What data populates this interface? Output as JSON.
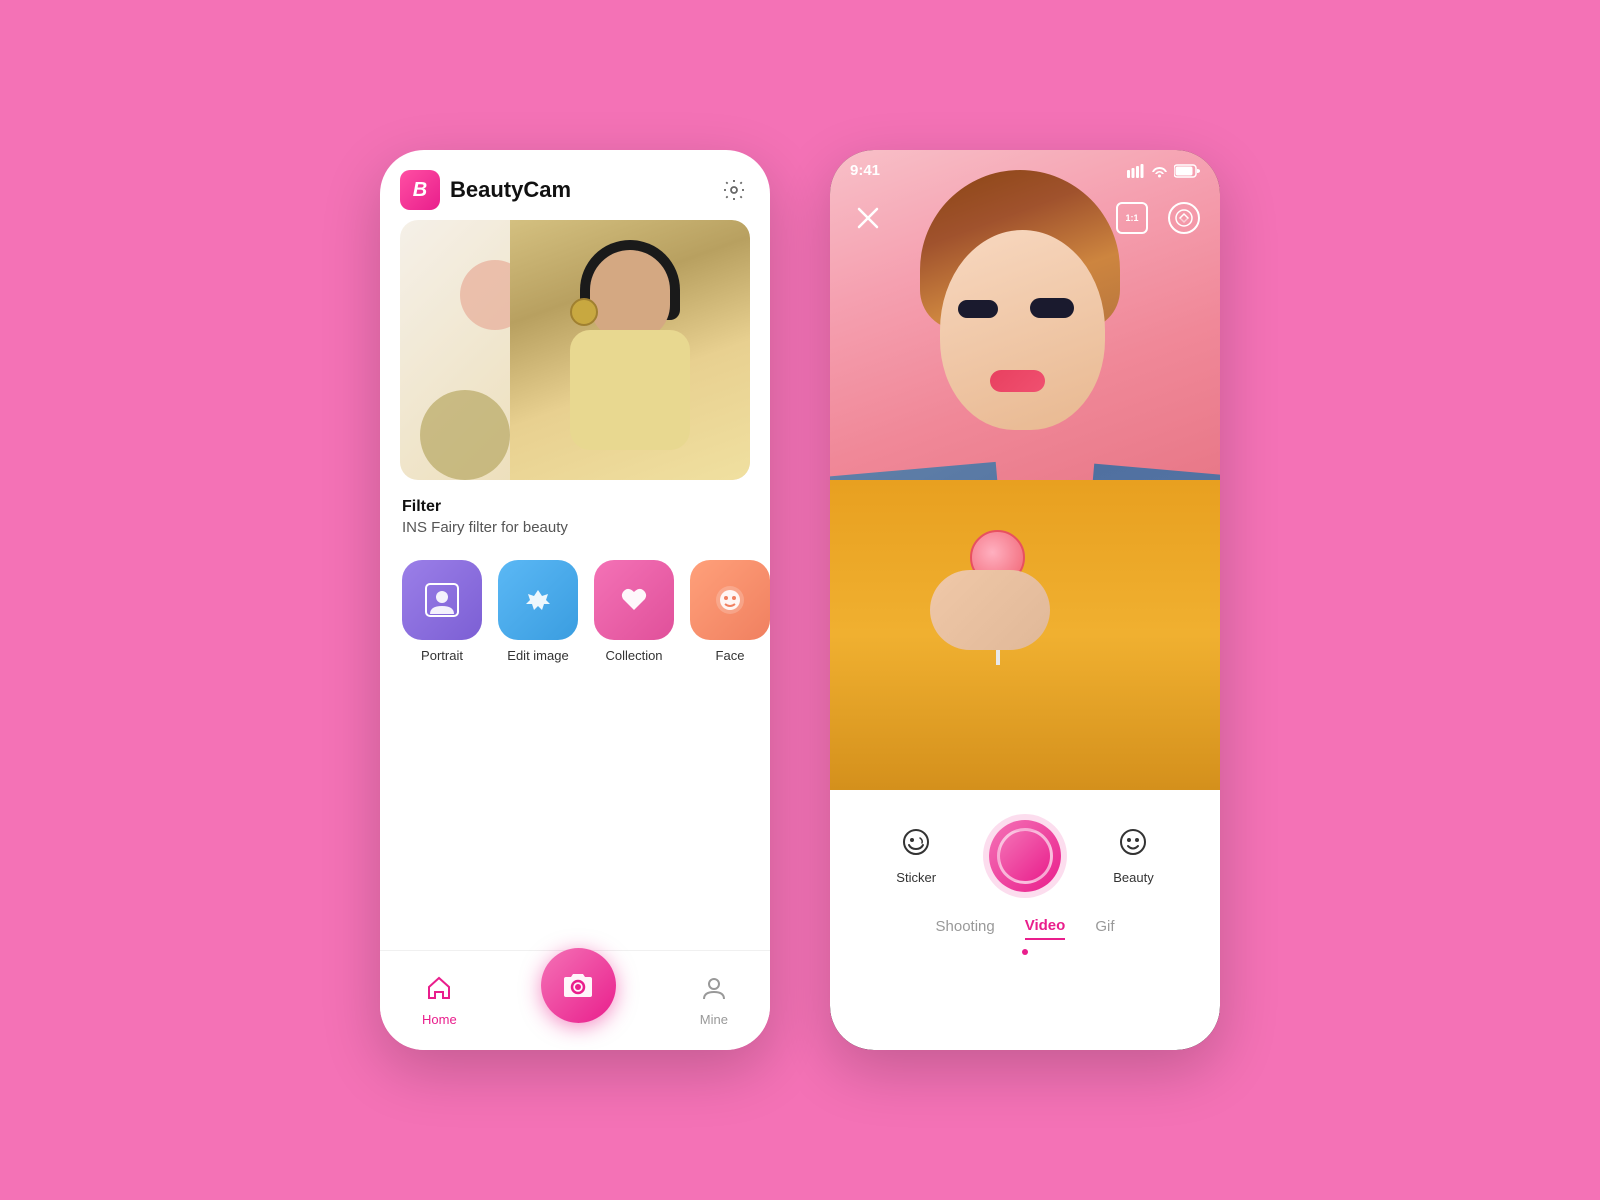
{
  "app": {
    "name": "BeautyCam",
    "logo_letter": "B",
    "time": "9:41"
  },
  "left_phone": {
    "header": {
      "title": "BeautyCam",
      "settings_label": "settings"
    },
    "banner": {
      "filter_label": "Filter",
      "filter_subtitle": "INS Fairy filter for beauty"
    },
    "features": [
      {
        "id": "portrait",
        "label": "Portrait",
        "icon": "👤"
      },
      {
        "id": "edit_image",
        "label": "Edit image",
        "icon": "✨"
      },
      {
        "id": "collection",
        "label": "Collection",
        "icon": "♥"
      },
      {
        "id": "face",
        "label": "Face",
        "icon": "😊"
      }
    ],
    "nav": {
      "home_label": "Home",
      "mine_label": "Mine",
      "camera_label": "camera"
    }
  },
  "right_phone": {
    "status_bar": {
      "time": "9:41",
      "signal": "▌▌▌▌",
      "wifi": "wifi",
      "battery": "battery"
    },
    "controls": {
      "sticker_label": "Sticker",
      "beauty_label": "Beauty"
    },
    "modes": {
      "shooting": "Shooting",
      "video": "Video",
      "gif": "Gif"
    }
  }
}
